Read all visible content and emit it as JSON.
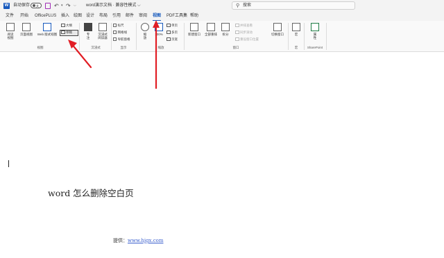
{
  "titlebar": {
    "app_icon": "word-app-icon",
    "logo_letter": "W",
    "autosave_label": "自动保存",
    "autosave_state": "关",
    "doc_title": "word演示文档 · 兼容性模式 ⌵",
    "search_placeholder": "搜索"
  },
  "menu": {
    "tabs": [
      "文件",
      "开始",
      "OfficePLUS",
      "插入",
      "绘图",
      "设计",
      "布局",
      "引用",
      "邮件",
      "审阅",
      "视图",
      "PDF工具集",
      "帮助"
    ],
    "active_tab": "视图"
  },
  "ribbon": {
    "views": {
      "read_mode": "阅读\n视图",
      "print_layout": "页面视图",
      "web_layout": "Web 版式视图",
      "outline": "大纲",
      "draft": "草稿",
      "group_label": "视图"
    },
    "immersive": {
      "focus": "专\n注",
      "immersive_reader": "沉浸式\n阅读器",
      "group_label": "沉浸式"
    },
    "show": {
      "ruler": "标尺",
      "gridlines": "网格线",
      "nav_pane": "导航窗格",
      "group_label": "显示"
    },
    "zoom": {
      "zoom": "缩\n放",
      "hundred": "100%",
      "one_page": "单页",
      "multi_page": "多页",
      "page_width": "页宽",
      "group_label": "缩放"
    },
    "window": {
      "new_window": "新建窗口",
      "arrange_all": "全部重排",
      "split": "拆分",
      "side_by_side": "并排查看",
      "sync_scroll": "同步滚动",
      "reset_position": "重设窗口位置",
      "switch_windows": "切换窗口",
      "group_label": "窗口"
    },
    "macros": {
      "macros": "宏",
      "group_label": "宏"
    },
    "sharepoint": {
      "properties": "属\n性",
      "group_label": "SharePoint"
    }
  },
  "document": {
    "heading": "word 怎么删除空白页",
    "footer_prefix": "提供：",
    "footer_link": "www.hjgx.com"
  }
}
